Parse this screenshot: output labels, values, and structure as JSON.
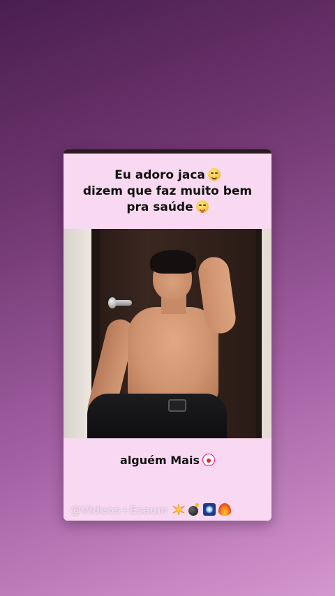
{
  "caption_top": {
    "line1": "Eu adoro jaca",
    "line1_emoji": "shushing-face-emoji",
    "line2": "dizem que faz muito bem",
    "line3": "pra saúde",
    "line3_emoji": "face-savoring-food-emoji"
  },
  "caption_bottom": {
    "text": "alguém Mais",
    "text_emoji": "clown-face-emoji"
  },
  "watermark": {
    "text": "@Videos+Esaum",
    "emojis": [
      "collision-icon",
      "bomb-icon",
      "firework-icon",
      "fire-icon"
    ]
  },
  "colors": {
    "background_top": "#4a1e4f",
    "background_bottom": "#d597cf",
    "caption_bg": "#f8d9f1",
    "caption_text": "#111111"
  }
}
